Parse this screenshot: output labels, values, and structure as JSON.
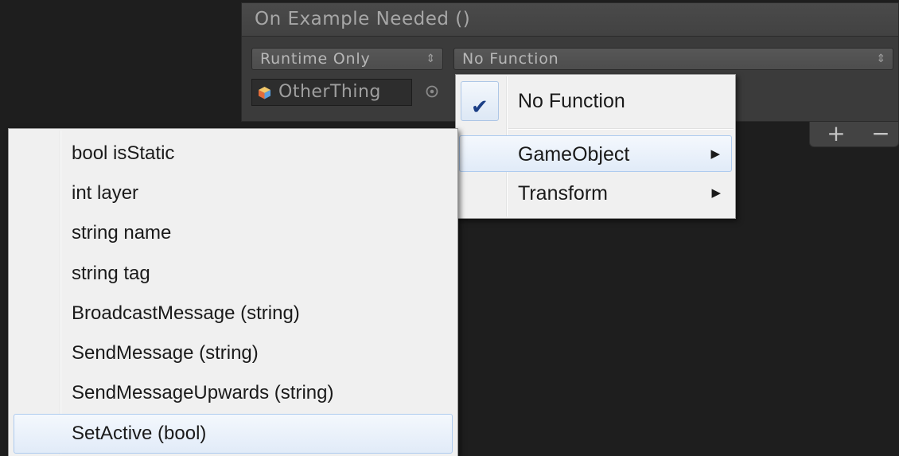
{
  "event": {
    "title": "On Example Needed ()",
    "runtime_dropdown": "Runtime Only",
    "function_dropdown": "No Function",
    "target_object": "OtherThing",
    "add_label": "+",
    "remove_label": "−"
  },
  "function_menu": {
    "items": [
      {
        "label": "No Function",
        "checked": true
      },
      {
        "label": "GameObject",
        "has_submenu": true,
        "highlighted": true
      },
      {
        "label": "Transform",
        "has_submenu": true
      }
    ]
  },
  "gameobject_submenu": {
    "items": [
      {
        "label": "bool isStatic"
      },
      {
        "label": "int layer"
      },
      {
        "label": "string name"
      },
      {
        "label": "string tag"
      },
      {
        "label": "BroadcastMessage (string)"
      },
      {
        "label": "SendMessage (string)"
      },
      {
        "label": "SendMessageUpwards (string)"
      },
      {
        "label": "SetActive (bool)",
        "highlighted": true
      }
    ]
  },
  "icons": {
    "dropdown": "up-down-arrow-icon",
    "object": "cube-icon",
    "picker": "object-picker-icon",
    "check": "checkmark-icon",
    "submenu": "triangle-right-icon"
  },
  "colors": {
    "panel": "#3b3b3b",
    "menu_bg": "#f0f0f0",
    "highlight_border": "#aecbef",
    "check": "#1c3f86"
  }
}
